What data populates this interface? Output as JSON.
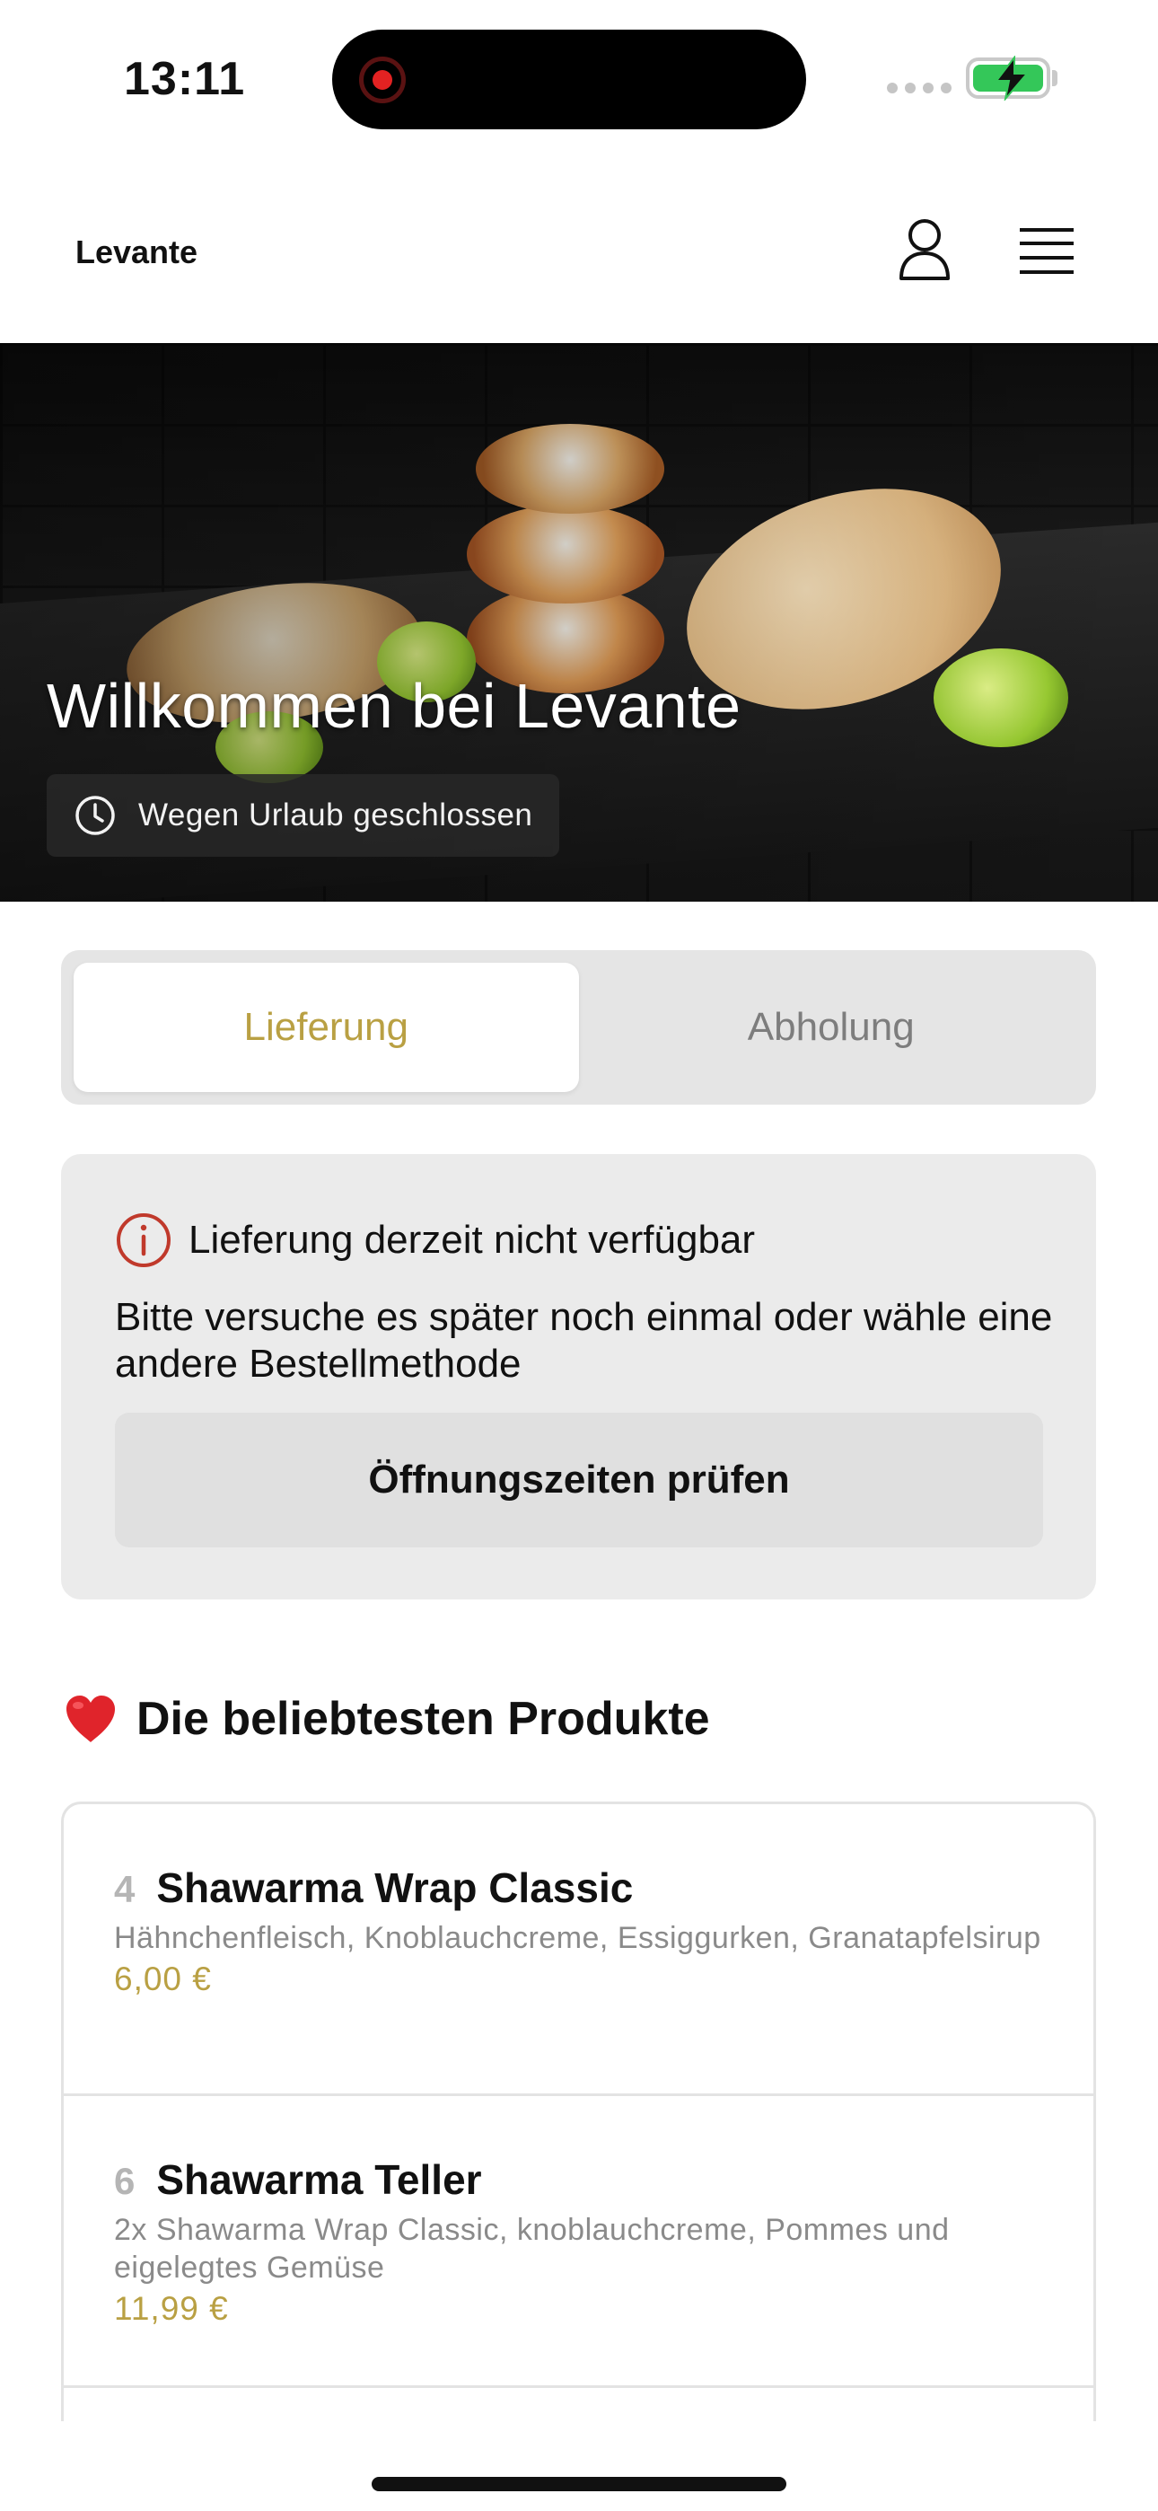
{
  "status_bar": {
    "time": "13:11"
  },
  "header": {
    "brand": "Levante"
  },
  "hero": {
    "title": "Willkommen bei Levante",
    "status": "Wegen Urlaub geschlossen"
  },
  "order_mode": {
    "options": [
      {
        "label": "Lieferung",
        "active": true
      },
      {
        "label": "Abholung",
        "active": false
      }
    ]
  },
  "notice": {
    "title": "Lieferung derzeit nicht verfügbar",
    "body": "Bitte versuche es später noch einmal oder wähle eine andere Bestellmethode",
    "button": "Öffnungszeiten prüfen"
  },
  "popular": {
    "title": "Die beliebtesten Produkte",
    "products": [
      {
        "number": "4",
        "name": "Shawarma Wrap Classic",
        "description": "Hähnchenfleisch, Knoblauchcreme, Essiggurken, Granatapfelsirup",
        "price": "6,00 €"
      },
      {
        "number": "6",
        "name": "Shawarma Teller",
        "description": "2x Shawarma Wrap Classic, knoblauchcreme, Pommes und eigelegtes Gemüse",
        "price": "11,99 €"
      }
    ]
  },
  "colors": {
    "accent": "#b9a043",
    "error": "#c0392b",
    "battery": "#34c759"
  }
}
